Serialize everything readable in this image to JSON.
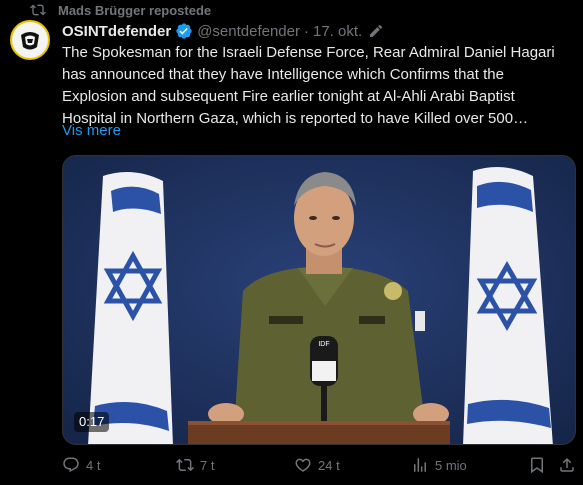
{
  "repost": {
    "text": "Mads Brügger repostede",
    "icon": "repost-icon"
  },
  "author": {
    "name": "OSINTdefender",
    "handle": "@sentdefender",
    "separator": "·",
    "date": "17. okt.",
    "verified_color": "#1d9bf0"
  },
  "tweet": {
    "text": "The Spokesman for the Israeli Defense Force, Rear Admiral Daniel Hagari has announced that they have Intelligence which Confirms that the Explosion and subsequent Fire earlier tonight at Al-Ahli Arabi Baptist Hospital in Northern Gaza, which is reported to have Killed over 500…",
    "show_more": "Vis mere"
  },
  "media": {
    "duration": "0:17",
    "type": "video",
    "mic_label": "IDF"
  },
  "actions": {
    "replies": "4 t",
    "reposts": "7 t",
    "likes": "24 t",
    "views": "5 mio"
  },
  "colors": {
    "background": "#000000",
    "text": "#e7e9ea",
    "muted": "#71767b",
    "link": "#1d9bf0"
  }
}
